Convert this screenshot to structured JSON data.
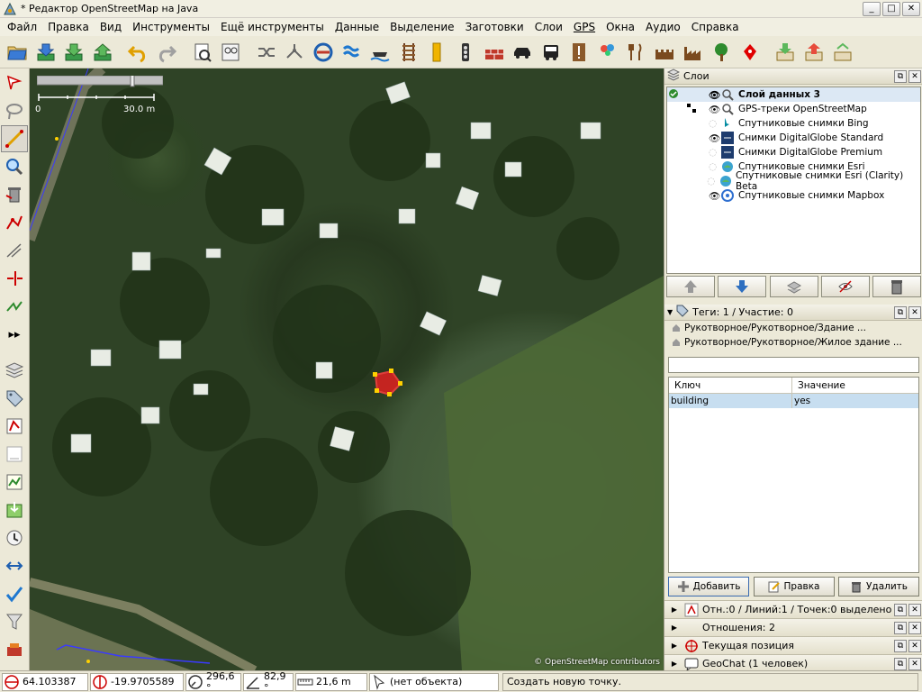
{
  "window": {
    "title": "* Редактор OpenStreetMap на Java",
    "buttons": [
      "minimize",
      "maximize",
      "close"
    ]
  },
  "menu": [
    "Файл",
    "Правка",
    "Вид",
    "Инструменты",
    "Ещё инструменты",
    "Данные",
    "Выделение",
    "Заготовки",
    "Слои",
    "GPS",
    "Окна",
    "Аудио",
    "Справка"
  ],
  "toolbar": {
    "icons": [
      "open-file-icon",
      "download-icon",
      "save-icon",
      "upload-icon",
      "undo-icon",
      "redo-icon",
      "preferences-icon",
      "search-presets-icon",
      "shuffle-icon",
      "merge-nodes-icon",
      "orthogonalize-icon",
      "water-icon",
      "ferry-icon",
      "railway-icon",
      "road-icon",
      "traffic-signals-icon",
      "wall-icon",
      "car-icon",
      "bus-icon",
      "exclamation-icon",
      "balloons-icon",
      "restaurant-icon",
      "castle-icon",
      "factory-icon",
      "tree-icon",
      "marker-icon",
      "download-layer-icon",
      "upload-layer-icon",
      "settings-icon"
    ]
  },
  "left_toolbar": {
    "icons": [
      "select-icon",
      "lasso-icon",
      "draw-line-icon",
      "zoom-icon",
      "delete-icon",
      "improve-way-icon",
      "parallel-icon",
      "split-way-icon",
      "extrude-icon",
      "expand-icon",
      "layers-toggle-icon",
      "tags-toggle-icon",
      "selection-list-icon",
      "relations-icon",
      "commands-icon",
      "download-area-icon",
      "history-icon",
      "conflict-icon",
      "validate-icon",
      "filter-icon",
      "notes-icon"
    ],
    "expand_label": "▸▸"
  },
  "map": {
    "scale_zero": "0",
    "scale_label": "30.0 m",
    "attribution": "© OpenStreetMap contributors"
  },
  "layers_panel": {
    "title": "Слои",
    "layers": [
      {
        "name": "Слой данных 3",
        "active": true,
        "visible": true,
        "icon": "data-layer-icon"
      },
      {
        "name": "GPS-треки OpenStreetMap",
        "active": false,
        "visible": true,
        "icon": "gps-tracks-icon"
      },
      {
        "name": "Спутниковые снимки Bing",
        "active": false,
        "visible": false,
        "icon": "bing-icon"
      },
      {
        "name": "Снимки DigitalGlobe Standard",
        "active": false,
        "visible": true,
        "icon": "digitalglobe-icon"
      },
      {
        "name": "Снимки DigitalGlobe Premium",
        "active": false,
        "visible": false,
        "icon": "digitalglobe-icon"
      },
      {
        "name": "Спутниковые снимки Esri",
        "active": false,
        "visible": false,
        "icon": "esri-icon"
      },
      {
        "name": "Спутниковые снимки Esri (Clarity) Beta",
        "active": false,
        "visible": false,
        "icon": "esri-icon"
      },
      {
        "name": "Спутниковые снимки Mapbox",
        "active": false,
        "visible": true,
        "icon": "mapbox-icon"
      }
    ],
    "buttons": [
      "move-up-icon",
      "move-down-icon",
      "merge-layer-icon",
      "toggle-visibility-icon",
      "delete-layer-icon"
    ]
  },
  "tags_panel": {
    "title": "Теги: 1 / Участие: 0",
    "presets": [
      "Рукотворное/Рукотворное/Здание ...",
      "Рукотворное/Рукотворное/Жилое здание ..."
    ],
    "columns": {
      "key": "Ключ",
      "value": "Значение"
    },
    "rows": [
      {
        "key": "building",
        "value": "yes"
      }
    ],
    "add_label": "Добавить",
    "edit_label": "Правка",
    "delete_label": "Удалить"
  },
  "collapsed_panels": [
    {
      "label": "Отн.:0 / Линий:1 / Точек:0 выделено",
      "icon": "selection-icon"
    },
    {
      "label": "Отношения: 2",
      "icon": "relations-icon"
    },
    {
      "label": "Текущая позиция",
      "icon": "position-icon"
    },
    {
      "label": "GeoChat (1 человек)",
      "icon": "geochat-icon"
    }
  ],
  "statusbar": {
    "lat": "64.103387",
    "lon": "-19.9705589",
    "heading": "296,6 °",
    "angle": "82,9 °",
    "distance": "21,6 m",
    "object": "(нет объекта)",
    "hint": "Создать новую точку."
  }
}
